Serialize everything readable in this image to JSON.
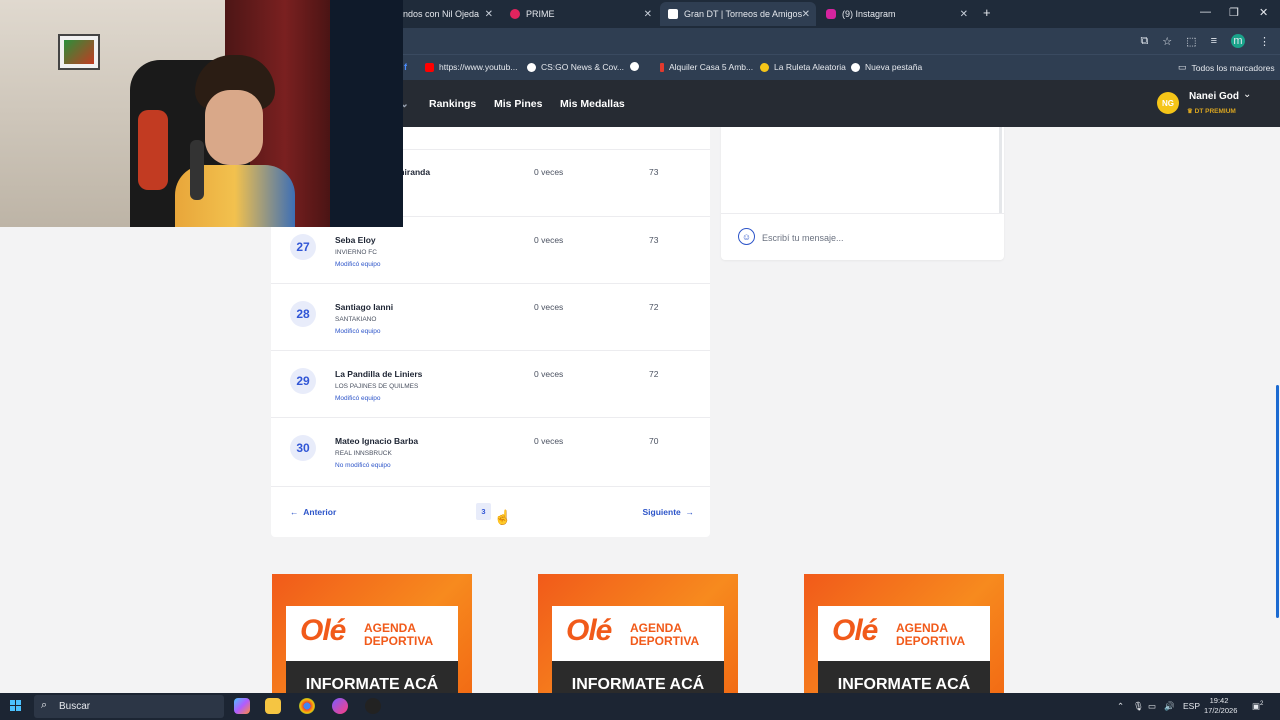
{
  "browser": {
    "tabs": [
      {
        "label": "ndos con Nil Ojeda",
        "favicon_color": "#1f2b3a"
      },
      {
        "label": "PRIME",
        "favicon_color": "#e0245e"
      },
      {
        "label": "Gran DT | Torneos de Amigos",
        "favicon_color": "#ffffff"
      },
      {
        "label": "(9) Instagram",
        "favicon_color": "#d6249f"
      }
    ],
    "new_tab": "+",
    "window_controls": [
      "—",
      "❐",
      "✕"
    ],
    "profile_initial": "m",
    "bookmarks": [
      {
        "label": "https://www.youtub...",
        "color": "#ff0000"
      },
      {
        "label": "CS:GO News & Cov...",
        "color": "#ffffff"
      },
      {
        "label": "",
        "color": "#ffffff"
      },
      {
        "label": "Alquiler Casa 5 Amb...",
        "color": "#e23a2e"
      },
      {
        "label": "La Ruleta Aleatoria",
        "color": "#f5c518"
      },
      {
        "label": "Nueva pestaña",
        "color": "#ffffff"
      }
    ],
    "all_bookmarks": "Todos los marcadores"
  },
  "site": {
    "nav": [
      "Rankings",
      "Mis Pines",
      "Mis Medallas"
    ],
    "user": {
      "initials": "NG",
      "name": "Nanei God",
      "badge": "DT PREMIUM"
    }
  },
  "ranking": {
    "partial_row": {
      "name": "miranda",
      "veces": "0 veces",
      "points": "73"
    },
    "rows": [
      {
        "pos": "27",
        "name": "Seba Eloy",
        "team": "INVIERNO FC",
        "status": "Modificó equipo",
        "veces": "0 veces",
        "points": "73"
      },
      {
        "pos": "28",
        "name": "Santiago Ianni",
        "team": "SANTAKIANO",
        "status": "Modificó equipo",
        "veces": "0 veces",
        "points": "72"
      },
      {
        "pos": "29",
        "name": "La Pandilla de Liniers",
        "team": "LOS PAJINES DE QUILMES",
        "status": "Modificó equipo",
        "veces": "0 veces",
        "points": "72"
      },
      {
        "pos": "30",
        "name": "Mateo Ignacio Barba",
        "team": "REAL INNSBRUCK",
        "status": "No modificó equipo",
        "veces": "0 veces",
        "points": "70"
      }
    ],
    "pager": {
      "prev": "Anterior",
      "page": "3",
      "next": "Siguiente"
    }
  },
  "chat": {
    "placeholder": "Escribí tu mensaje..."
  },
  "ads": [
    {
      "brand": "Olé",
      "line1": "AGENDA",
      "line2": "DEPORTIVA",
      "cta": "INFORMATE ACÁ"
    },
    {
      "brand": "Olé",
      "line1": "AGENDA",
      "line2": "DEPORTIVA",
      "cta": "INFORMATE ACÁ"
    },
    {
      "brand": "Olé",
      "line1": "AGENDA",
      "line2": "DEPORTIVA",
      "cta": "INFORMATE ACÁ"
    }
  ],
  "taskbar": {
    "search": "Buscar",
    "lang": "ESP",
    "time": "19:42",
    "date": "17/2/2026",
    "notifications": "2"
  }
}
